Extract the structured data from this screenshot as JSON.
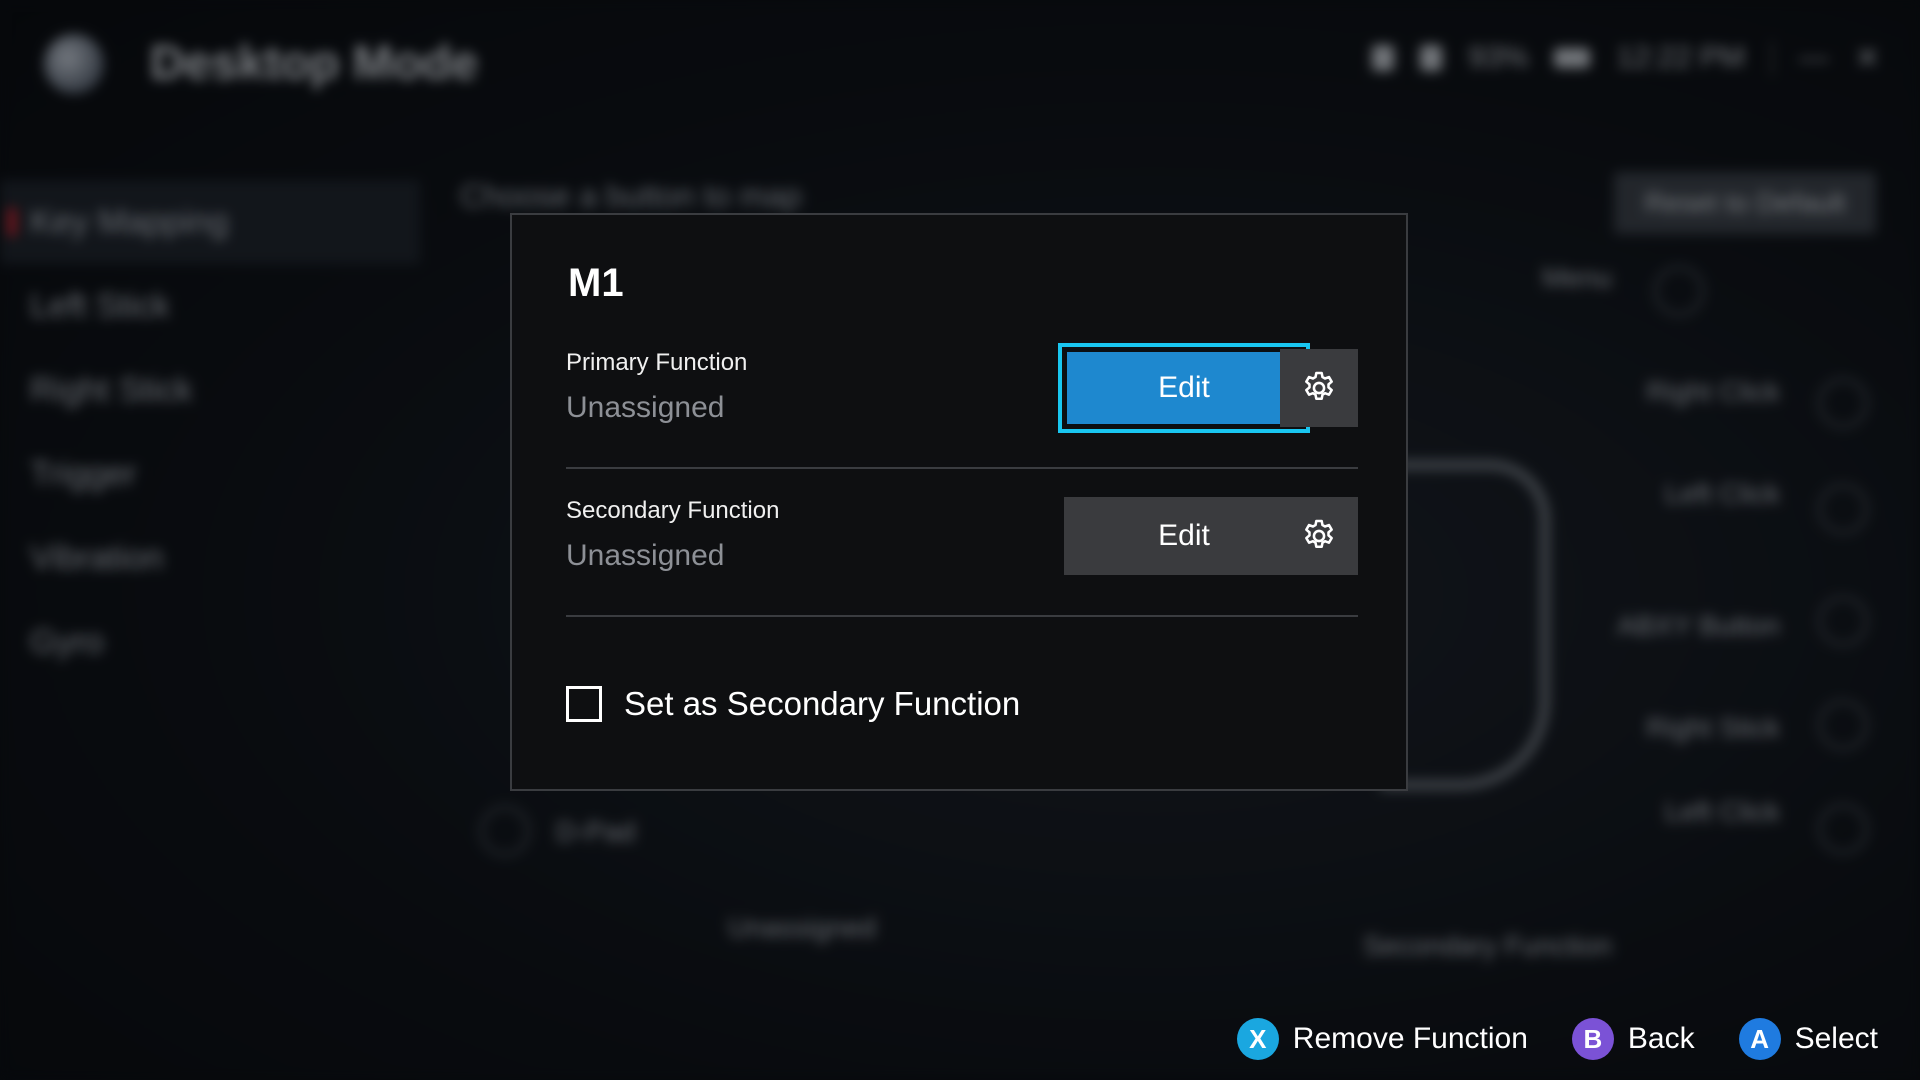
{
  "app": {
    "title": "Desktop Mode",
    "status": {
      "battery": "93%",
      "time": "12:22 PM"
    }
  },
  "background": {
    "hint": "Choose a button to map",
    "reset_label": "Reset to Default",
    "sidebar": [
      {
        "label": "Key Mapping",
        "active": true
      },
      {
        "label": "Left Stick",
        "active": false
      },
      {
        "label": "Right Stick",
        "active": false
      },
      {
        "label": "Trigger",
        "active": false
      },
      {
        "label": "Vibration",
        "active": false
      },
      {
        "label": "Gyro",
        "active": false
      }
    ],
    "right_labels": [
      "Menu",
      "Right Click",
      "Left Click",
      "ABXY Button",
      "Right Stick",
      "Left Click",
      "Secondary Function"
    ],
    "left_labels": [
      "D-Pad",
      "Unassigned"
    ]
  },
  "modal": {
    "title": "M1",
    "primary": {
      "label": "Primary Function",
      "value": "Unassigned",
      "edit_label": "Edit"
    },
    "secondary": {
      "label": "Secondary Function",
      "value": "Unassigned",
      "edit_label": "Edit"
    },
    "checkbox": {
      "label": "Set as Secondary Function",
      "checked": false
    }
  },
  "footer": {
    "hints": [
      {
        "button": "X",
        "label": "Remove Function",
        "color": "#1aa7e0"
      },
      {
        "button": "B",
        "label": "Back",
        "color": "#7b52d6"
      },
      {
        "button": "A",
        "label": "Select",
        "color": "#1f7be0"
      }
    ]
  },
  "colors": {
    "accent": "#1e88cf",
    "focus_ring": "#19c6f0"
  }
}
